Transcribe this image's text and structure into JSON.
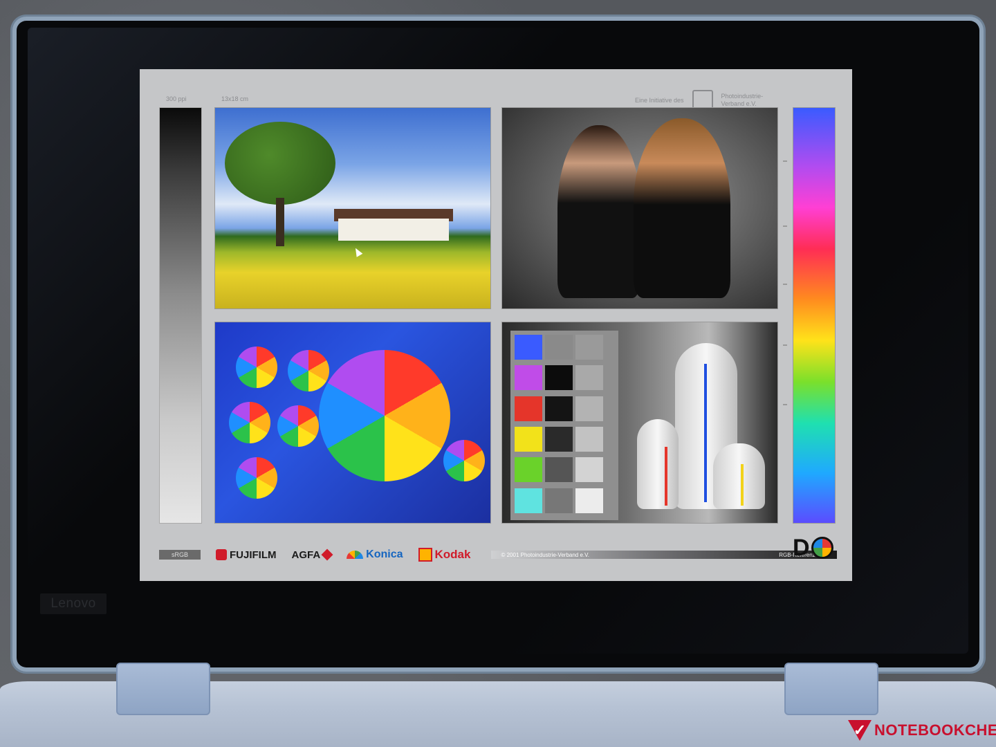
{
  "laptop": {
    "brand_label": "Lenovo"
  },
  "watermark": {
    "text": "NOTEBOOKCHECK"
  },
  "testchart": {
    "resolution_label": "300 ppi",
    "size_label": "13x18 cm",
    "initiative_label": "Eine Initiative des",
    "organization_line1": "Photoindustrie-",
    "organization_line2": "Verband e.V.",
    "colorspace_label": "sRGB",
    "logos": {
      "fujifilm": "FUJIFILM",
      "agfa": "AGFA",
      "konica": "Konica",
      "kodak": "Kodak"
    },
    "copyright": "© 2001  Photoindustrie-Verband e.V.",
    "reference": "RGB-Referenzdatei",
    "dq_logo": "D"
  },
  "swatches": {
    "colors": [
      "#3a5bff",
      "#8a8a8a",
      "#9a9a9a",
      "#c04ce8",
      "#0c0c0c",
      "#a9a9a9",
      "#e5352a",
      "#141414",
      "#b3b3b3",
      "#f2e21a",
      "#2a2a2a",
      "#c2c2c2",
      "#6ad22a",
      "#555555",
      "#d3d3d3",
      "#5fe3e0",
      "#777777",
      "#ececec"
    ]
  },
  "colors": {
    "bezel": "#08090b",
    "chart_background": "#c5c6c8",
    "notebookcheck_red": "#c8102e"
  }
}
